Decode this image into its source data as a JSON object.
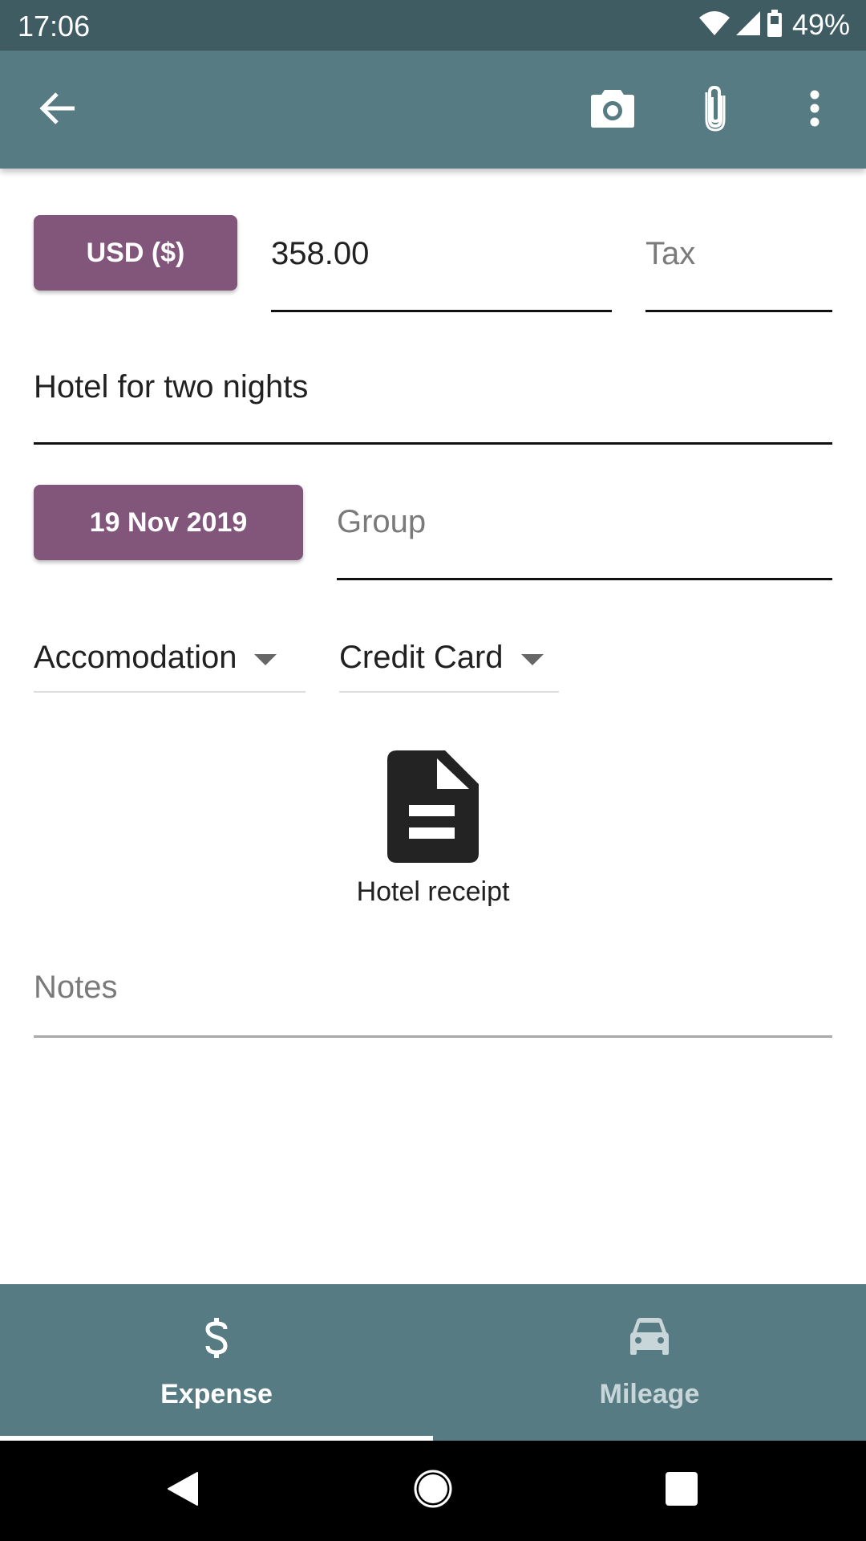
{
  "status_bar": {
    "time": "17:06",
    "battery_percent": "49%",
    "icons": [
      "wifi-icon",
      "cellular-signal-icon",
      "battery-icon"
    ]
  },
  "app_bar": {
    "actions": [
      {
        "name": "back",
        "icon": "arrow-back-icon"
      },
      {
        "name": "camera",
        "icon": "camera-icon"
      },
      {
        "name": "attach",
        "icon": "paperclip-icon"
      },
      {
        "name": "more",
        "icon": "more-vert-icon"
      }
    ]
  },
  "form": {
    "currency_button": "USD ($)",
    "amount_value": "358.00",
    "tax_placeholder": "Tax",
    "description_value": "Hotel for two nights",
    "date_button": "19 Nov 2019",
    "group_placeholder": "Group",
    "category_selected": "Accomodation",
    "payment_method_selected": "Credit Card",
    "notes_placeholder": "Notes"
  },
  "attachment": {
    "icon": "document-icon",
    "caption": "Hotel receipt"
  },
  "bottom_nav": {
    "tabs": [
      {
        "label": "Expense",
        "icon": "dollar-icon",
        "active": true
      },
      {
        "label": "Mileage",
        "icon": "car-icon",
        "active": false
      }
    ]
  },
  "system_nav": {
    "buttons": [
      "back-triangle-icon",
      "home-circle-icon",
      "recents-square-icon"
    ]
  },
  "colors": {
    "status_bar": "#405c63",
    "app_bar": "#567b82",
    "accent_button": "#82557a",
    "inactive_tab_text": "#c9d6d9"
  }
}
